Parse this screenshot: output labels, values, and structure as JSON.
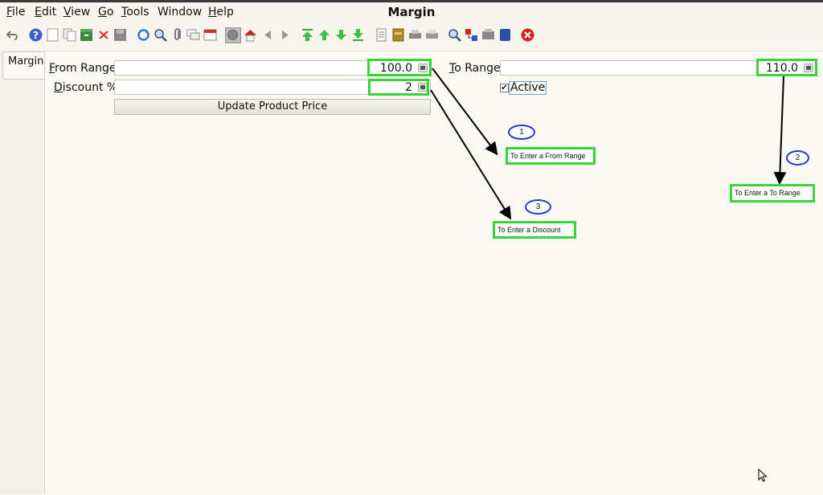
{
  "menu": {
    "file": {
      "mnemonic": "F",
      "rest": "ile"
    },
    "edit": {
      "mnemonic": "E",
      "rest": "dit"
    },
    "view": {
      "mnemonic": "V",
      "rest": "iew"
    },
    "go": {
      "mnemonic": "G",
      "rest": "o"
    },
    "tools": {
      "mnemonic": "T",
      "rest": "ools"
    },
    "window": {
      "label": "Window"
    },
    "help": {
      "mnemonic": "H",
      "rest": "elp"
    }
  },
  "window_title": "Margin",
  "toolbar": {
    "icons": [
      "undo-icon",
      "help-icon",
      "new-record-icon",
      "copy-record-icon",
      "archive-icon",
      "delete-icon",
      "save-icon",
      "refresh-icon",
      "find-icon",
      "attachment-icon",
      "chat-icon",
      "grid-toggle-icon",
      "history-icon",
      "home-icon",
      "previous-icon",
      "next-icon",
      "first-record-icon",
      "parent-record-icon",
      "detail-record-icon",
      "last-record-icon",
      "report-icon",
      "archive-doc-icon",
      "print-preview-icon",
      "print-icon",
      "zoom-across-icon",
      "workflow-icon",
      "request-icon",
      "product-info-icon",
      "close-window-icon"
    ]
  },
  "tabs": {
    "margin": "Margin"
  },
  "form": {
    "from_range": {
      "mnemonic": "F",
      "rest": "rom Range",
      "value": "100.0"
    },
    "to_range": {
      "mnemonic": "T",
      "rest": "o Range",
      "value": "110.0"
    },
    "discount": {
      "mnemonic": "D",
      "rest": "iscount %",
      "value": "2"
    },
    "active": {
      "label": "Active",
      "checked": "✔"
    },
    "update_button": "Update Product Price"
  },
  "annotations": [
    {
      "number": "1",
      "text": "To Enter a From Range"
    },
    {
      "number": "2",
      "text": "To Enter a To Range"
    },
    {
      "number": "3",
      "text": "To Enter a Discount"
    }
  ],
  "colors": {
    "highlight": "#3ad33a",
    "circle": "#2a35d8",
    "background": "#f8f5ef"
  }
}
